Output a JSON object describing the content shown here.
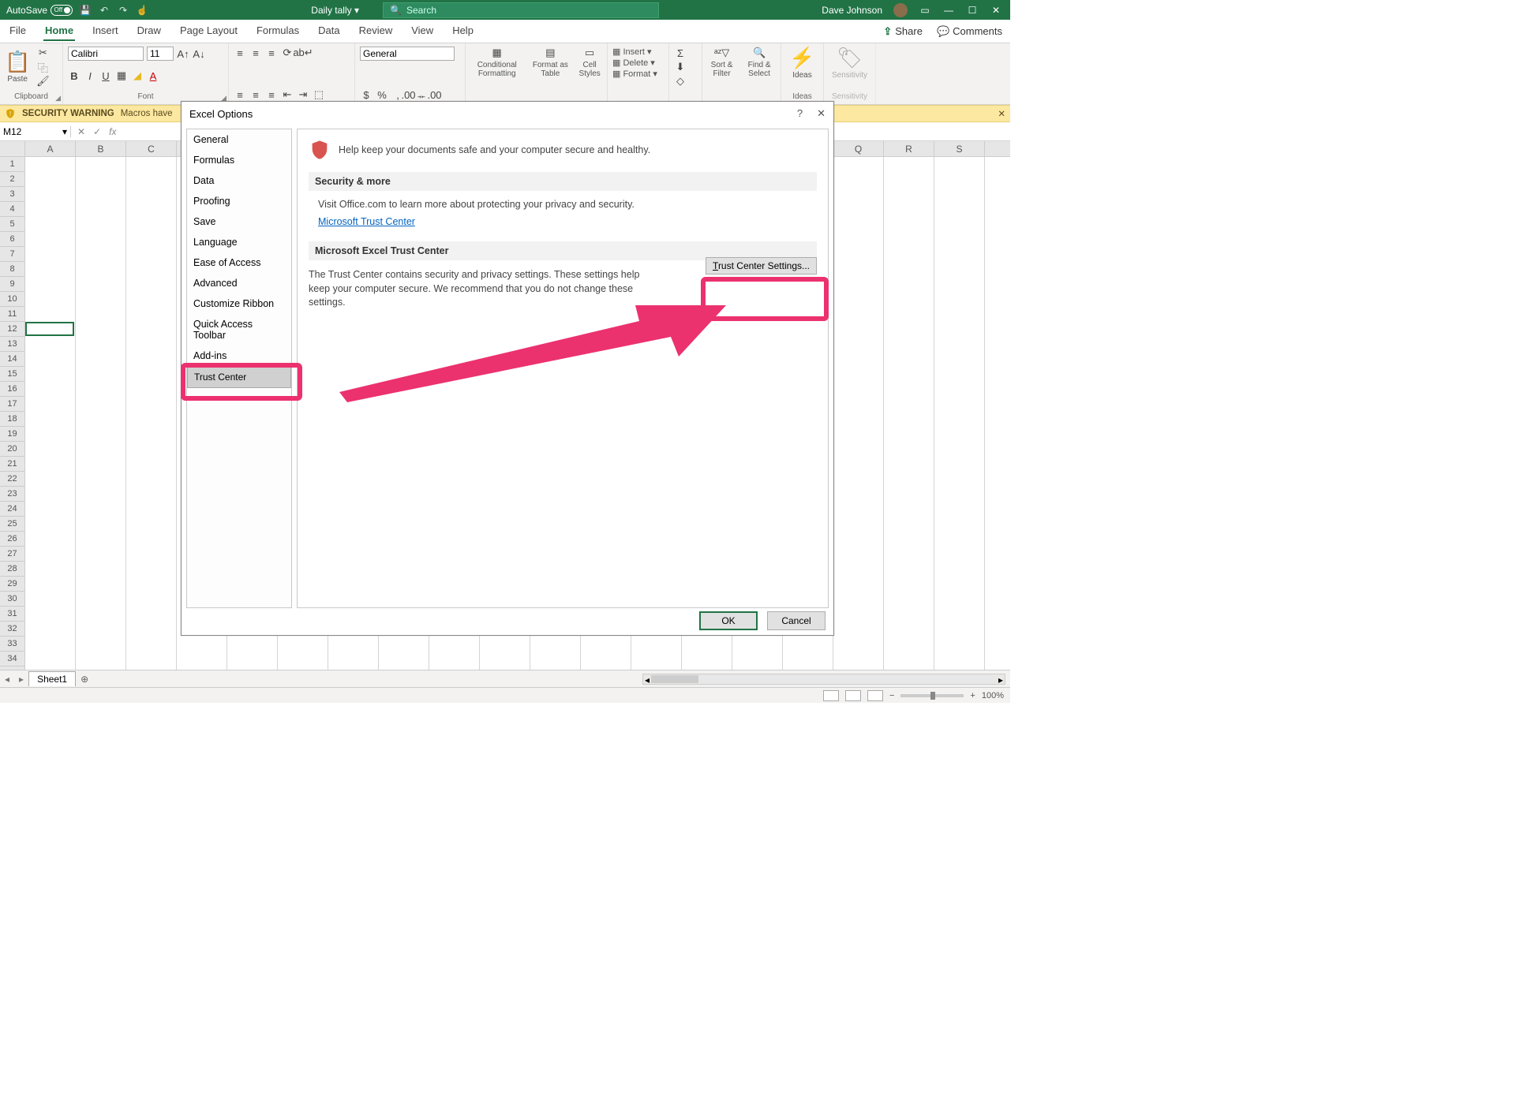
{
  "titlebar": {
    "autosave": "AutoSave",
    "toggle": "Off",
    "docname": "Daily tally",
    "search_ph": "Search",
    "username": "Dave Johnson"
  },
  "tabs": {
    "file": "File",
    "home": "Home",
    "insert": "Insert",
    "draw": "Draw",
    "page": "Page Layout",
    "formulas": "Formulas",
    "data": "Data",
    "review": "Review",
    "view": "View",
    "help": "Help",
    "share": "Share",
    "comments": "Comments"
  },
  "ribbon": {
    "clipboard": "Clipboard",
    "paste": "Paste",
    "font": "Font",
    "fontname": "Calibri",
    "fontsize": "11",
    "number": "General",
    "cond": "Conditional Formatting",
    "fmtas": "Format as Table",
    "cellst": "Cell Styles",
    "insert": "Insert",
    "delete": "Delete",
    "format": "Format",
    "sort": "Sort & Filter",
    "find": "Find & Select",
    "ideas": "Ideas",
    "sens": "Sensitivity"
  },
  "secwarn": {
    "title": "SECURITY WARNING",
    "msg": "Macros have"
  },
  "cellref": "M12",
  "cols": [
    "A",
    "B",
    "C",
    "",
    "",
    "",
    "",
    "",
    "",
    "",
    "",
    "",
    "",
    "",
    "",
    "",
    "Q",
    "R",
    "S"
  ],
  "dialog": {
    "title": "Excel Options",
    "nav": [
      "General",
      "Formulas",
      "Data",
      "Proofing",
      "Save",
      "Language",
      "Ease of Access",
      "Advanced",
      "Customize Ribbon",
      "Quick Access Toolbar",
      "Add-ins",
      "Trust Center"
    ],
    "hdr": "Help keep your documents safe and your computer secure and healthy.",
    "sec1": "Security & more",
    "sec1_body": "Visit Office.com to learn more about protecting your privacy and security.",
    "link": "Microsoft Trust Center",
    "sec2": "Microsoft Excel Trust Center",
    "sec2_body": "The Trust Center contains security and privacy settings. These settings help keep your computer secure. We recommend that you do not change these settings.",
    "tc_btn": "Trust Center Settings...",
    "ok": "OK",
    "cancel": "Cancel"
  },
  "sheet": "Sheet1",
  "zoom": "100%"
}
